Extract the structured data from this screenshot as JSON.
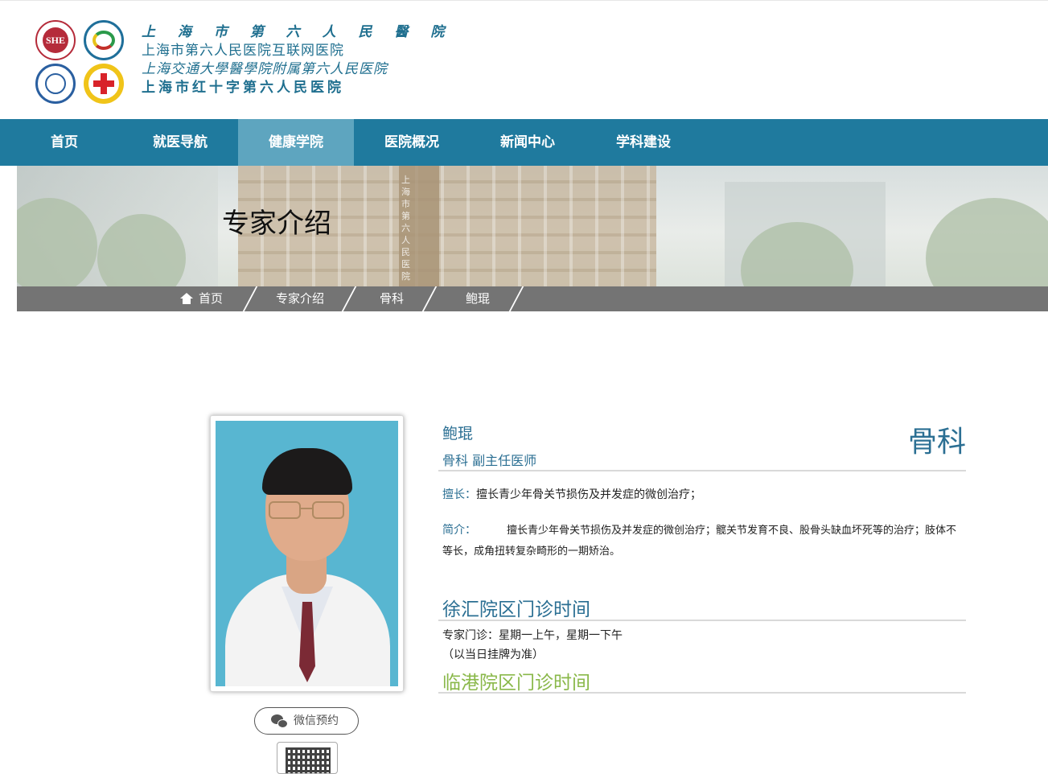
{
  "header": {
    "logo_lines": [
      "上 海 市 第 六 人 民 醫 院",
      "上海市第六人民医院互联网医院",
      "上海交通大學醫學院附属第六人民医院",
      "上海市红十字第六人民医院"
    ],
    "seal1_text": "SHE"
  },
  "nav": {
    "items": [
      {
        "label": "首页"
      },
      {
        "label": "就医导航"
      },
      {
        "label": "健康学院"
      },
      {
        "label": "医院概况"
      },
      {
        "label": "新闻中心"
      },
      {
        "label": "学科建设"
      }
    ],
    "active_index": 2,
    "bg_color": "#1f7a9e",
    "active_color": "#5ea5bf"
  },
  "banner": {
    "title": "专家介绍",
    "tower_text": "上海市第六人民医院"
  },
  "breadcrumb": {
    "items": [
      "首页",
      "专家介绍",
      "骨科",
      "鲍琨"
    ]
  },
  "doctor": {
    "name": "鲍琨",
    "title": "骨科 副主任医师",
    "department": "骨科",
    "specialty_label": "擅长：",
    "specialty": "擅长青少年骨关节损伤及并发症的微创治疗；",
    "intro_label": "简介：",
    "intro": "擅长青少年骨关节损伤及并发症的微创治疗；髋关节发育不良、股骨头缺血坏死等的治疗；肢体不等长，成角扭转复杂畸形的一期矫治。"
  },
  "schedule": {
    "xuhui_title": "徐汇院区门诊时间",
    "xuhui_line1": "专家门诊：星期一上午，星期一下午",
    "xuhui_line2": "（以当日挂牌为准）",
    "lingang_title": "临港院区门诊时间"
  },
  "actions": {
    "wechat_label": "微信预约"
  },
  "colors": {
    "accent": "#2b6f93",
    "lingang": "#8ab84a",
    "breadcrumb_bg": "#747474"
  }
}
